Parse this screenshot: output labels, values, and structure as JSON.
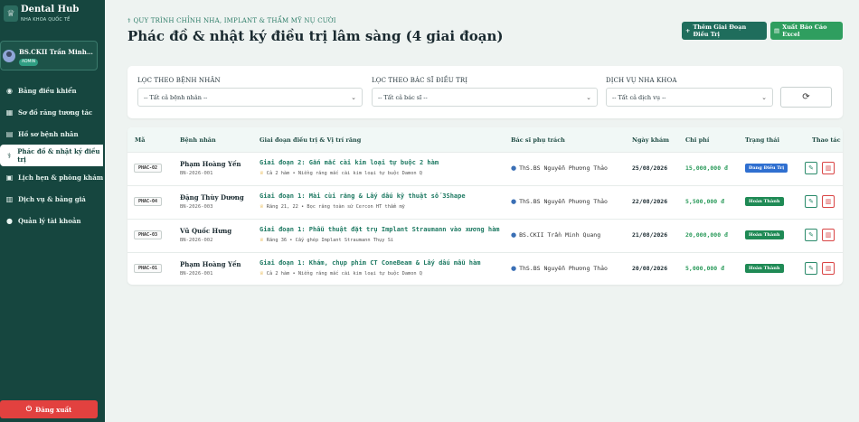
{
  "sidebar": {
    "brand_title": "Dental Hub",
    "brand_sub": "NHA KHOA QUỐC TẾ",
    "user_name": "BS.CKII Trần Minh Qu...",
    "user_role": "ADMIN",
    "items": [
      {
        "label": "Bảng điều khiển",
        "icon": "home-icon",
        "active": false
      },
      {
        "label": "Sơ đồ răng tương tác",
        "icon": "grid-icon",
        "active": false
      },
      {
        "label": "Hồ sơ bệnh nhân",
        "icon": "folder-icon",
        "active": false
      },
      {
        "label": "Phác đồ & nhật ký điều trị",
        "icon": "stethoscope-icon",
        "active": true
      },
      {
        "label": "Lịch hẹn & phòng khám",
        "icon": "calendar-icon",
        "active": false
      },
      {
        "label": "Dịch vụ & bảng giá",
        "icon": "price-icon",
        "active": false
      },
      {
        "label": "Quản lý tài khoản",
        "icon": "user-icon",
        "active": false
      }
    ],
    "logout_label": "Đăng xuất"
  },
  "header": {
    "breadcrumb": "QUY TRÌNH CHỈNH NHA, IMPLANT & THẨM MỸ NỤ CƯỜI",
    "title": "Phác đồ & nhật ký điều trị lâm sàng (4 giai đoạn)",
    "add_button": "Thêm Giai Đoạn Điều Trị",
    "export_button": "Xuất Báo Cáo Excel"
  },
  "filters": {
    "patient_label": "LỌC THEO BỆNH NHÂN",
    "patient_value": "-- Tất cả bệnh nhân --",
    "doctor_label": "LỌC THEO BÁC SĨ ĐIỀU TRỊ",
    "doctor_value": "-- Tất cả bác sĩ --",
    "service_label": "DỊCH VỤ NHA KHOA",
    "service_value": "-- Tất cả dịch vụ --"
  },
  "table": {
    "headers": {
      "code": "Mã",
      "patient": "Bệnh nhân",
      "stage": "Giai đoạn điều trị & Vị trí răng",
      "doctor": "Bác sĩ phụ trách",
      "date": "Ngày khám",
      "cost": "Chi phí",
      "status": "Trạng thái",
      "actions": "Thao tác"
    },
    "rows": [
      {
        "code": "PHAC-02",
        "patient": "Phạm Hoàng Yến",
        "patient_code": "BN-2026-001",
        "stage": "Giai đoạn 2: Gắn mắc cài kim loại tự buộc 2 hàm",
        "note": "Cả 2 hàm • Niềng răng mắc cài kim loại tự buộc Damon Q",
        "doctor": "ThS.BS Nguyễn Phương Thảo",
        "date": "25/08/2026",
        "cost": "15,000,000 đ",
        "status": "Đang Điều Trị",
        "status_type": "progress"
      },
      {
        "code": "PHAC-04",
        "patient": "Đặng Thùy Dương",
        "patient_code": "BN-2026-003",
        "stage": "Giai đoạn 1: Mài cùi răng & Lấy dấu kỹ thuật số 3Shape",
        "note": "Răng 21, 22 • Bọc răng toàn sứ Cercon HT thẩm mỹ",
        "doctor": "ThS.BS Nguyễn Phương Thảo",
        "date": "22/08/2026",
        "cost": "5,500,000 đ",
        "status": "Hoàn Thành",
        "status_type": "done"
      },
      {
        "code": "PHAC-03",
        "patient": "Vũ Quốc Hưng",
        "patient_code": "BN-2026-002",
        "stage": "Giai đoạn 1: Phẫu thuật đặt trụ Implant Straumann vào xương hàm",
        "note": "Răng 36 • Cấy ghép Implant Straumann Thụy Sĩ",
        "doctor": "BS.CKII Trần Minh Quang",
        "date": "21/08/2026",
        "cost": "20,000,000 đ",
        "status": "Hoàn Thành",
        "status_type": "done"
      },
      {
        "code": "PHAC-01",
        "patient": "Phạm Hoàng Yến",
        "patient_code": "BN-2026-001",
        "stage": "Giai đoạn 1: Khám, chụp phim CT ConeBeam & Lấy dấu mẫu hàm",
        "note": "Cả 2 hàm • Niềng răng mắc cài kim loại tự buộc Damon Q",
        "doctor": "ThS.BS Nguyễn Phương Thảo",
        "date": "20/08/2026",
        "cost": "5,000,000 đ",
        "status": "Hoàn Thành",
        "status_type": "done"
      }
    ]
  }
}
